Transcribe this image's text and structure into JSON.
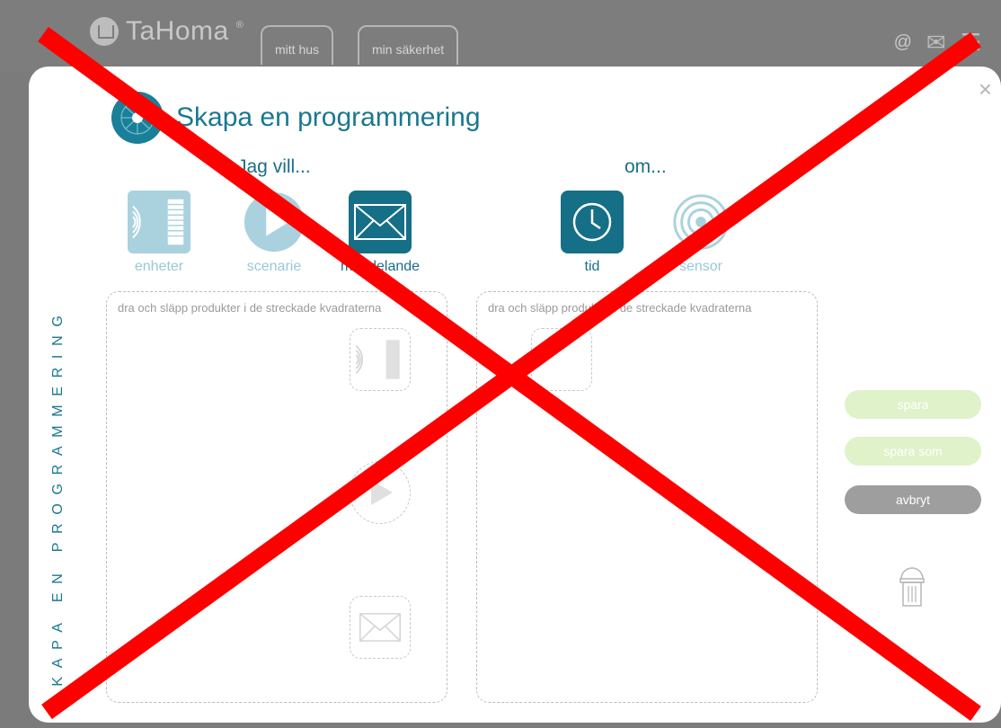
{
  "app": {
    "name": "TaHoma",
    "registered": "®"
  },
  "header": {
    "tabs": [
      {
        "label": "mitt hus"
      },
      {
        "label": "min säkerhet"
      }
    ],
    "icons": [
      "email-status-icon",
      "mail-icon",
      "menu-icon"
    ]
  },
  "modal": {
    "title": "Skapa en programmering",
    "vertical_label": "SKAPA EN PROGRAMMERING",
    "actions_heading": "Jag vill...",
    "conditions_heading": "om...",
    "actions": [
      {
        "label": "enheter",
        "icon": "devices-icon",
        "active": false
      },
      {
        "label": "scenarie",
        "icon": "play-icon",
        "active": false
      },
      {
        "label": "meddelande",
        "icon": "envelope-icon",
        "active": true
      }
    ],
    "conditions": [
      {
        "label": "tid",
        "icon": "clock-icon",
        "active": true
      },
      {
        "label": "sensor",
        "icon": "sensor-icon",
        "active": false
      }
    ],
    "dropzone_hint": "dra och släpp produkter i de streckade kvadraterna",
    "buttons": {
      "save": "spara",
      "save_as": "spara som",
      "cancel": "avbryt"
    },
    "close_glyph": "×"
  },
  "colors": {
    "accent": "#1a7890",
    "muted": "#98c8d6",
    "overlay_x": "#ff0000",
    "save_btn": "#dff2c9",
    "cancel_btn": "#9e9e9e"
  }
}
